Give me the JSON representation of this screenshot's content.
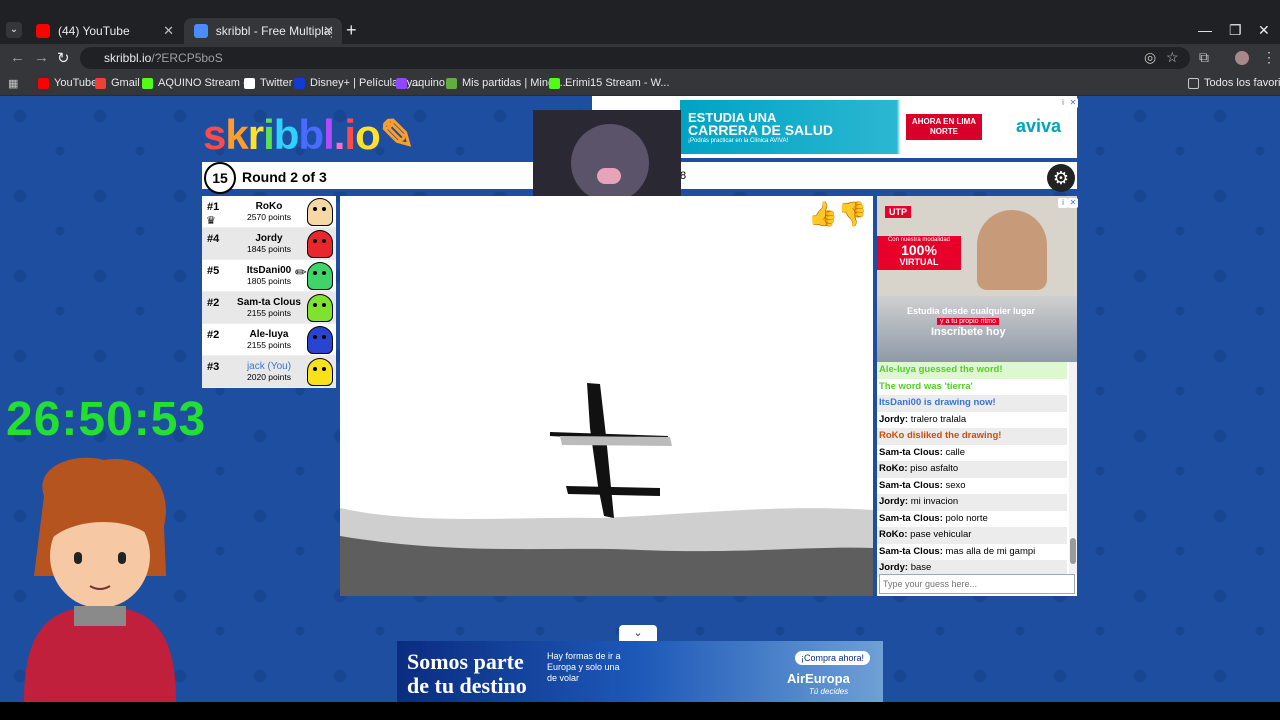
{
  "browser": {
    "tabs": [
      {
        "label": "(44) YouTube",
        "favicon_color": "#ff0000"
      },
      {
        "label": "skribbl - Free Multiplayer Drawi",
        "favicon_color": "#4a8cff"
      }
    ],
    "url_host": "skribbl.io",
    "url_path": "/?ERCP5boS",
    "bookmarks": [
      {
        "label": "YouTube",
        "color": "#ff0000"
      },
      {
        "label": "Gmail",
        "color": "#ea4335"
      },
      {
        "label": "AQUINO Stream -...",
        "color": "#53fc18"
      },
      {
        "label": "Twitter",
        "color": "#ffffff"
      },
      {
        "label": "Disney+ | Películas y...",
        "color": "#113ccf"
      },
      {
        "label": "aquino",
        "color": "#9146ff"
      },
      {
        "label": "Mis partidas | Minec...",
        "color": "#5fae3f"
      },
      {
        "label": "Erimi15 Stream - W...",
        "color": "#53fc18"
      }
    ],
    "all_bookmarks": "Todos los favoritos"
  },
  "game": {
    "logo": "skribbl.io",
    "timer": "15",
    "round": "Round 2 of 3",
    "word_hint": "8",
    "players": [
      {
        "rank": "#1",
        "name": "RoKo",
        "points": "2570 points",
        "color": "#f6d7a6",
        "crown": true,
        "you": false
      },
      {
        "rank": "#4",
        "name": "Jordy",
        "points": "1845 points",
        "color": "#e8262e",
        "crown": false,
        "you": false
      },
      {
        "rank": "#5",
        "name": "ItsDani00",
        "points": "1805 points",
        "color": "#3ed46a",
        "crown": false,
        "you": false,
        "drawing": true
      },
      {
        "rank": "#2",
        "name": "Sam-ta Clous",
        "points": "2155 points",
        "color": "#7ee22e",
        "crown": false,
        "you": false
      },
      {
        "rank": "#2",
        "name": "Ale-luya",
        "points": "2155 points",
        "color": "#2844d0",
        "crown": false,
        "you": false
      },
      {
        "rank": "#3",
        "name": "jack (You)",
        "points": "2020 points",
        "color": "#f7e01c",
        "crown": false,
        "you": true
      }
    ],
    "chat": [
      {
        "name": "",
        "text": "Ale-luya guessed the word!",
        "color": "#56ce27",
        "bg": "#ddf7cf"
      },
      {
        "name": "",
        "text": "The word was 'tierra'",
        "color": "#56ce27",
        "bg": "#ffffff"
      },
      {
        "name": "",
        "text": "ItsDani00 is drawing now!",
        "color": "#3975ce",
        "bg": "#ececec"
      },
      {
        "name": "Jordy:",
        "text": "tralero tralala",
        "color": "#000000",
        "bg": "#ffffff"
      },
      {
        "name": "",
        "text": "RoKo disliked the drawing!",
        "color": "#ce4f0a",
        "bg": "#ececec"
      },
      {
        "name": "Sam-ta Clous:",
        "text": "calle",
        "color": "#000000",
        "bg": "#ffffff"
      },
      {
        "name": "RoKo:",
        "text": "piso asfalto",
        "color": "#000000",
        "bg": "#ececec"
      },
      {
        "name": "Sam-ta Clous:",
        "text": "sexo",
        "color": "#000000",
        "bg": "#ffffff"
      },
      {
        "name": "Jordy:",
        "text": "mi invacion",
        "color": "#000000",
        "bg": "#ececec"
      },
      {
        "name": "Sam-ta Clous:",
        "text": "polo norte",
        "color": "#000000",
        "bg": "#ffffff"
      },
      {
        "name": "RoKo:",
        "text": "pase vehicular",
        "color": "#000000",
        "bg": "#ececec"
      },
      {
        "name": "Sam-ta Clous:",
        "text": "mas alla de mi gampi",
        "color": "#000000",
        "bg": "#ffffff"
      },
      {
        "name": "Jordy:",
        "text": "base",
        "color": "#000000",
        "bg": "#ececec"
      }
    ],
    "chat_placeholder": "Type your guess here..."
  },
  "overlay": {
    "clock": "26:50:53"
  },
  "ads": {
    "top": {
      "line1": "ESTUDIA UNA",
      "line2": "CARRERA DE SALUD",
      "line3": "¡Podrás practicar en la Clínica AVIVA!",
      "cta": "AHORA EN LIMA NORTE",
      "brand": "aviva"
    },
    "side": {
      "brand": "UTP",
      "tag1": "Con nuestra modalidad",
      "tag2": "100%",
      "tag3": "VIRTUAL",
      "line1": "Estudia desde cualquier lugar",
      "line2": "y a tu propio ritmo",
      "cta": "Inscríbete hoy"
    },
    "bottom": {
      "line1": "Somos parte",
      "line2": "de tu destino",
      "sub": "Hay formas de ir a Europa y solo una de volar",
      "cta": "¡Compra ahora!",
      "brand": "AirEuropa",
      "tagline": "Tú decides"
    }
  }
}
